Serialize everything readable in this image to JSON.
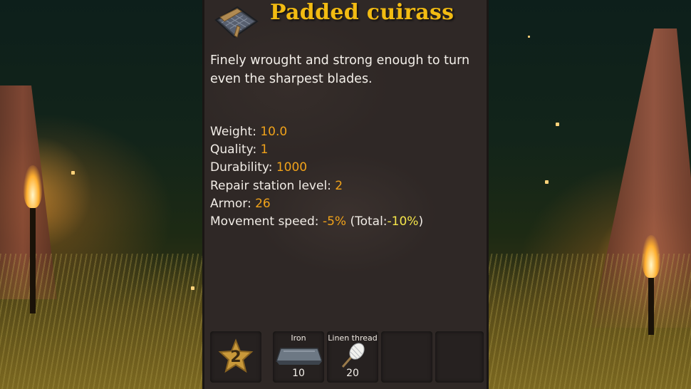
{
  "item": {
    "name": "Padded cuirass",
    "icon": "padded-cuirass-icon",
    "description": "Finely wrought and strong enough to turn even the sharpest blades."
  },
  "stats": [
    {
      "label": "Weight: ",
      "value": "10.0"
    },
    {
      "label": "Quality: ",
      "value": "1"
    },
    {
      "label": "Durability: ",
      "value": "1000"
    },
    {
      "label": "Repair station level: ",
      "value": "2"
    },
    {
      "label": "Armor: ",
      "value": "26"
    }
  ],
  "movement": {
    "label": "Movement speed: ",
    "value": "-5%",
    "total_open": " (Total:",
    "total_value": "-10%",
    "total_close": ")"
  },
  "upgrade": {
    "quality": "2",
    "icon": "star-icon"
  },
  "requirements": [
    {
      "name": "Iron",
      "amount": "10",
      "icon": "iron-bar-icon"
    },
    {
      "name": "Linen thread",
      "amount": "20",
      "icon": "linen-thread-icon"
    }
  ],
  "colors": {
    "title": "#f2bb12",
    "value": "#f0a21a",
    "total": "#f6e64a",
    "panel": "#2f2826"
  }
}
